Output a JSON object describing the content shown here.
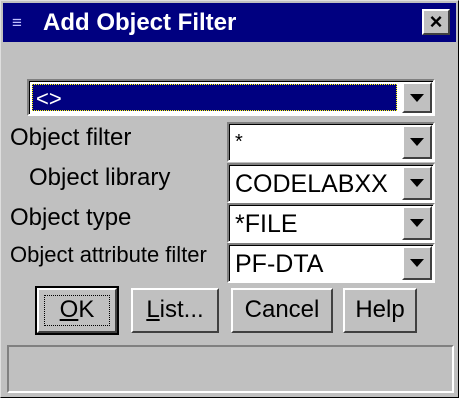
{
  "window": {
    "title": "Add Object Filter",
    "close_glyph": "×"
  },
  "top_combo": {
    "value": "<>"
  },
  "fields": [
    {
      "label": "Object filter",
      "value": "*"
    },
    {
      "label": "Object library",
      "value": "CODELABXX"
    },
    {
      "label": "Object type",
      "value": "*FILE"
    },
    {
      "label": "Object attribute filter",
      "value": "PF-DTA"
    }
  ],
  "buttons": {
    "ok": {
      "mnemonic": "O",
      "rest": "K"
    },
    "list": {
      "mnemonic": "L",
      "rest": "ist..."
    },
    "cancel": "Cancel",
    "help": "Help"
  },
  "statusbar": {
    "text": ""
  },
  "colors": {
    "titlebar": "#000080",
    "face": "#c0c0c0",
    "selection": "#000080"
  }
}
